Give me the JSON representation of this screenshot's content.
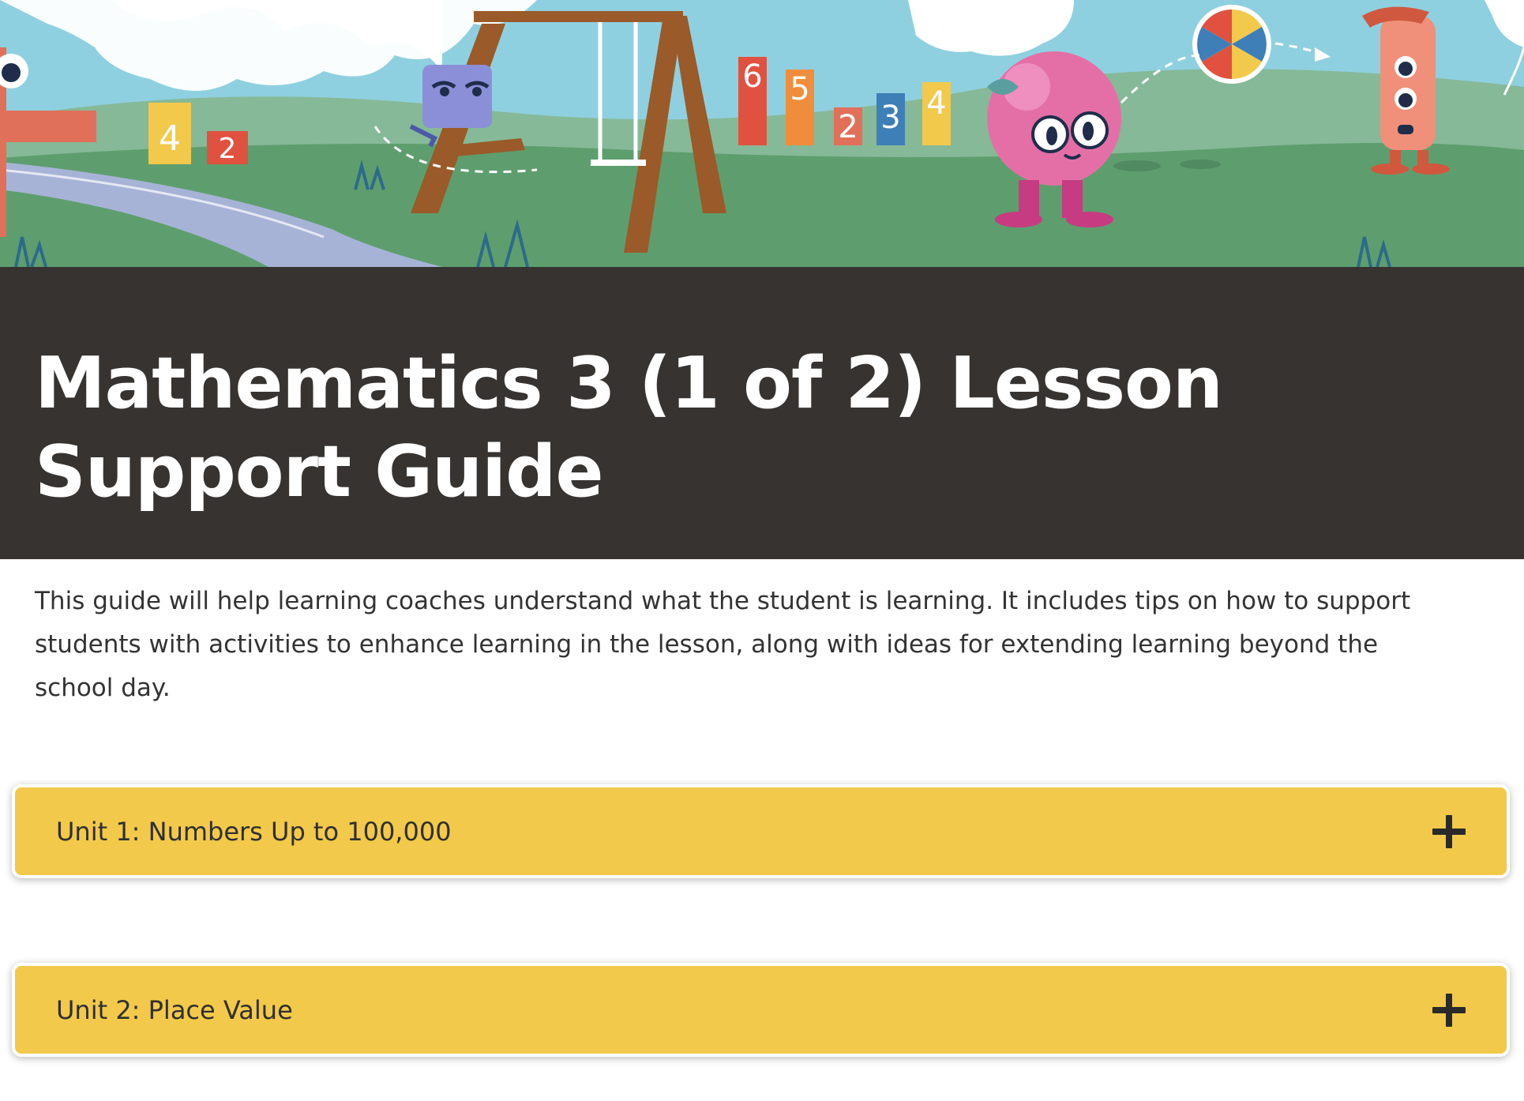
{
  "page": {
    "title": "Mathematics 3 (1 of 2) Lesson Support Guide",
    "intro": "This guide will help learning coaches understand what the student is learning. It includes tips on how to support students with activities to enhance learning in the lesson, along with ideas for extending learning beyond the school day."
  },
  "hero": {
    "description_icon": "playground-illustration",
    "number_blocks": [
      "4",
      "2",
      "6",
      "5",
      "2",
      "3",
      "4"
    ]
  },
  "units": [
    {
      "label": "Unit 1: Numbers Up to 100,000",
      "icon": "plus-icon"
    },
    {
      "label": "Unit 2: Place Value",
      "icon": "plus-icon"
    }
  ],
  "colors": {
    "title_band": "#363331",
    "accordion": "#f2c94a",
    "sky": "#8fd0e0",
    "grass": "#5e9e6e"
  }
}
